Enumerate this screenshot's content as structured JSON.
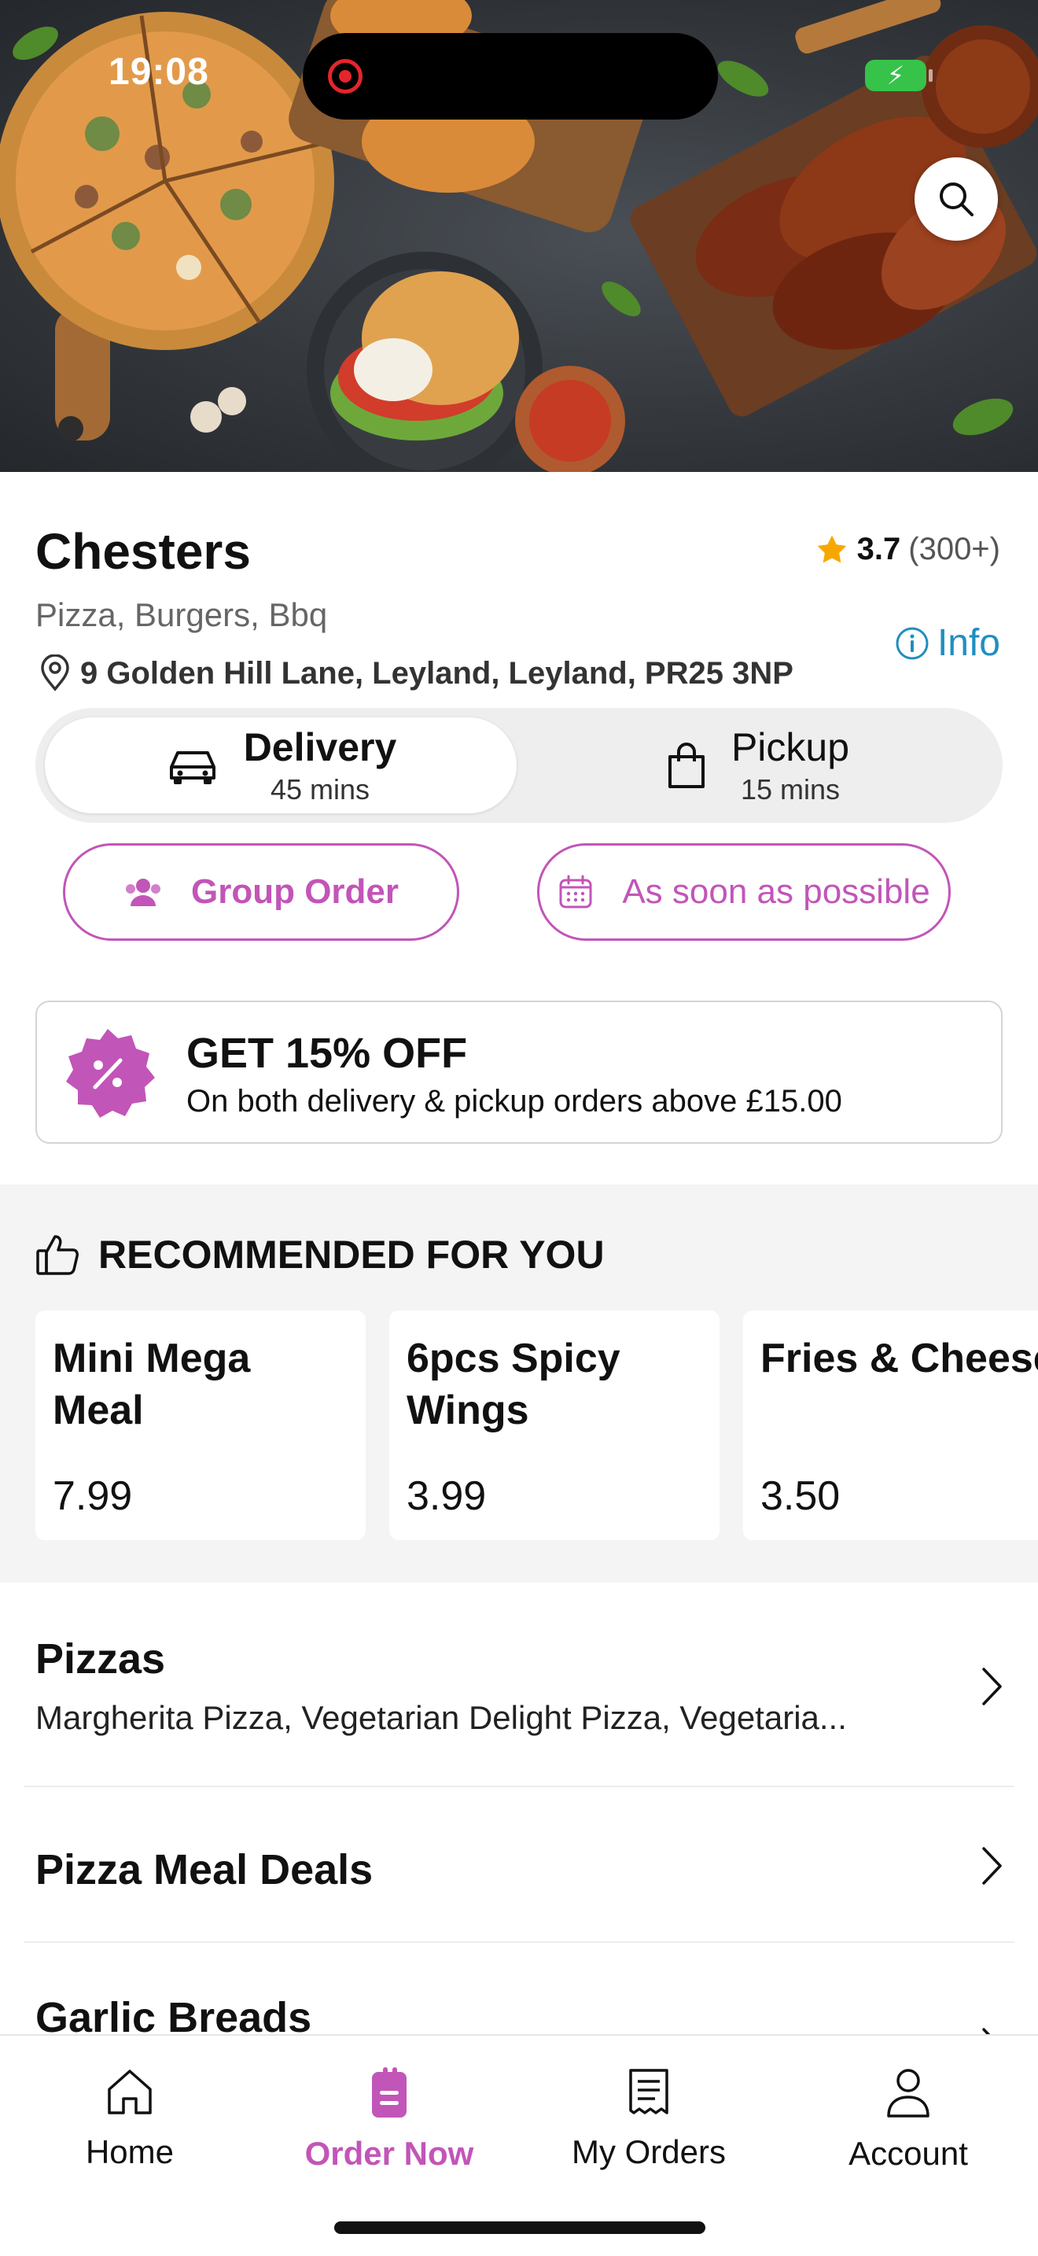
{
  "status_bar": {
    "time": "19:08",
    "battery_icon": "bolt-icon"
  },
  "colors": {
    "brand": "#c255b8",
    "info": "#1f8fbf",
    "star": "#f6a800",
    "recording": "#e5252a"
  },
  "restaurant": {
    "name": "Chesters",
    "rating": "3.7",
    "rating_count": "(300+)",
    "cuisines": "Pizza, Burgers, Bbq",
    "info_label": "Info",
    "address": "9 Golden Hill Lane, Leyland, Leyland, PR25 3NP"
  },
  "order_mode": {
    "delivery": {
      "label": "Delivery",
      "time": "45 mins",
      "selected": true
    },
    "pickup": {
      "label": "Pickup",
      "time": "15 mins",
      "selected": false
    }
  },
  "actions": {
    "group_order": "Group Order",
    "schedule": "As soon as possible"
  },
  "promo": {
    "badge_icon": "percent-badge-icon",
    "title": "GET 15% OFF",
    "subtitle": "On both delivery & pickup orders above £15.00"
  },
  "recommended": {
    "heading": "RECOMMENDED FOR YOU",
    "items": [
      {
        "name": "Mini Mega Meal",
        "price": "7.99"
      },
      {
        "name": "6pcs Spicy Wings",
        "price": "3.99"
      },
      {
        "name": "Fries & Cheese",
        "price": "3.50"
      }
    ]
  },
  "categories": [
    {
      "title": "Pizzas",
      "subtitle": "Margherita Pizza, Vegetarian Delight Pizza, Vegetaria..."
    },
    {
      "title": "Pizza Meal Deals",
      "subtitle": ""
    },
    {
      "title": "Garlic Breads",
      "subtitle": ""
    }
  ],
  "tabbar": [
    {
      "label": "Home",
      "icon": "home-icon",
      "active": false
    },
    {
      "label": "Order Now",
      "icon": "order-icon",
      "active": true
    },
    {
      "label": "My Orders",
      "icon": "receipt-icon",
      "active": false
    },
    {
      "label": "Account",
      "icon": "person-icon",
      "active": false
    }
  ]
}
